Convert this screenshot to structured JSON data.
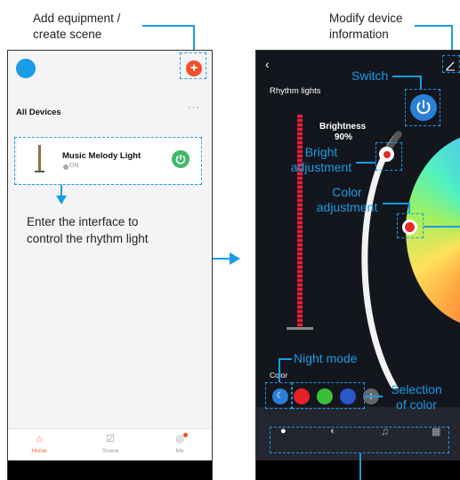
{
  "annotations": {
    "add_equipment": "Add equipment /\ncreate scene",
    "modify_device": "Modify device\ninformation",
    "enter_interface": "Enter the interface to\ncontrol the rhythm light",
    "switch": "Switch",
    "bright_adjustment": "Bright\nadjustment",
    "color_adjustment": "Color\nadjustment",
    "night_mode": "Night mode",
    "selection_of_color": "Selection\nof color"
  },
  "home": {
    "section_title": "All Devices",
    "more_icon": "more-dots-icon",
    "device_name": "Music Melody Light",
    "device_status": "ON",
    "tabs": [
      {
        "label": "Home",
        "icon": "home-icon",
        "active": true
      },
      {
        "label": "Scene",
        "icon": "scene-icon",
        "active": false
      },
      {
        "label": "Me",
        "icon": "profile-icon",
        "active": false
      }
    ]
  },
  "device": {
    "title": "Rhythm lights",
    "brightness_label": "Brightness",
    "brightness_value": "90%",
    "brightness_level": 0.9,
    "color_section_label": "Color",
    "preset_colors": [
      "#e8202a",
      "#3bbf3b",
      "#2b57c9"
    ],
    "toolbar_icons": [
      "bulb-icon",
      "palette-icon",
      "music-icon",
      "grid-icon"
    ]
  },
  "colors": {
    "accent": "#1a9be6",
    "add_button": "#f24f2a",
    "power_green": "#3fb868",
    "home_active": "#f26b2b"
  }
}
